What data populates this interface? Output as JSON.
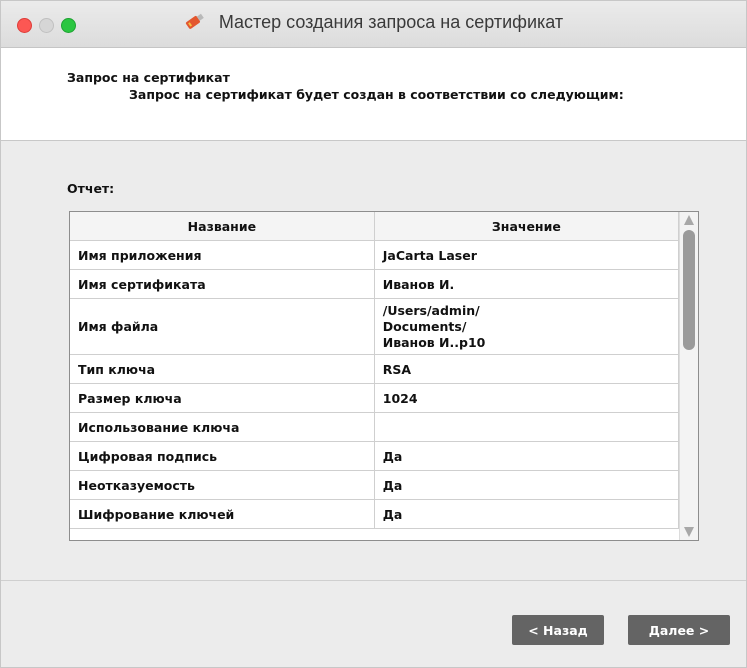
{
  "window": {
    "title": "Мастер создания запроса на сертификат",
    "colors": {
      "close": "#fc5753",
      "maximize": "#2bc641",
      "button": "#646464"
    }
  },
  "header": {
    "title": "Запрос на сертификат",
    "subtitle": "Запрос на сертификат будет создан в соответствии со следующим:"
  },
  "report": {
    "label": "Отчет:",
    "columns": [
      "Название",
      "Значение"
    ],
    "rows": [
      {
        "name": "Имя приложения",
        "value": "JaCarta Laser"
      },
      {
        "name": "Имя сертификата",
        "value": "Иванов И."
      },
      {
        "name": "Имя файла",
        "value_lines": [
          "/Users/admin/",
          "Documents/",
          "Иванов И..p10"
        ]
      },
      {
        "name": "Тип ключа",
        "value": "RSA"
      },
      {
        "name": "Размер ключа",
        "value": "1024"
      },
      {
        "name": "Использование ключа",
        "value": ""
      },
      {
        "name": "Цифровая подпись",
        "value": "Да"
      },
      {
        "name": "Неотказуемость",
        "value": "Да"
      },
      {
        "name": "Шифрование ключей",
        "value": "Да"
      }
    ]
  },
  "buttons": {
    "back": "< Назад",
    "next": "Далее >"
  },
  "icons": {
    "title": "usb-token-icon"
  }
}
